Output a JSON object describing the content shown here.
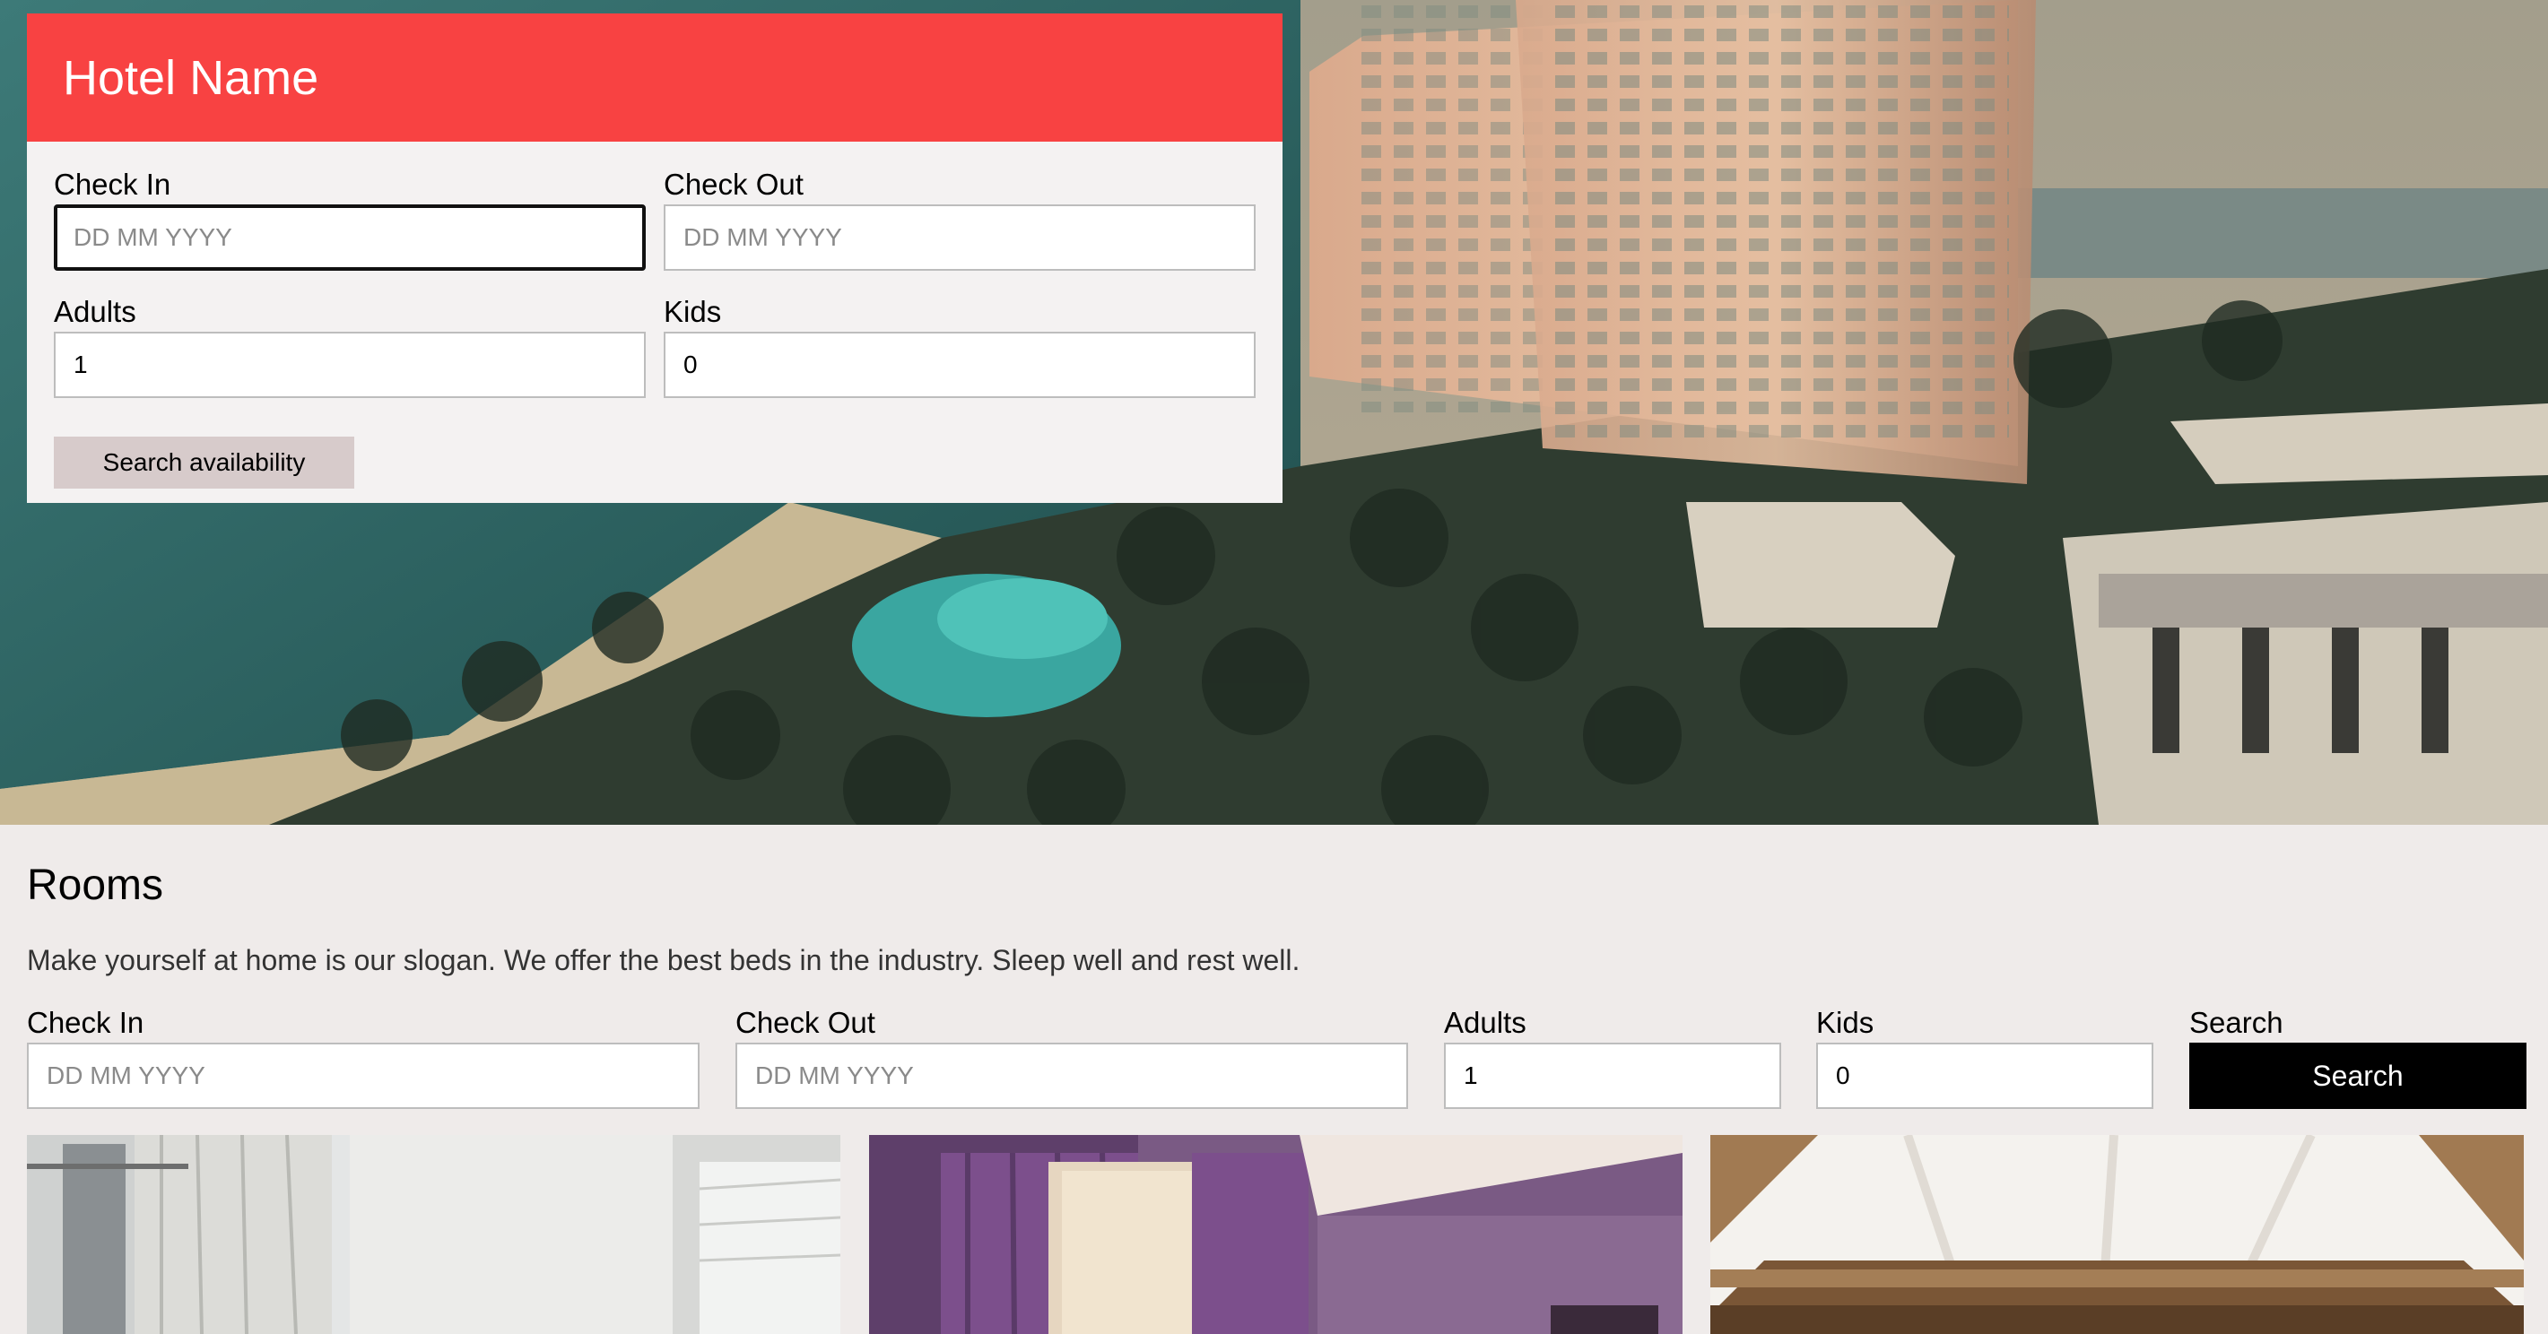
{
  "hotel": {
    "name": "Hotel Name"
  },
  "booking_form": {
    "check_in": {
      "label": "Check In",
      "placeholder": "DD MM YYYY"
    },
    "check_out": {
      "label": "Check Out",
      "placeholder": "DD MM YYYY"
    },
    "adults": {
      "label": "Adults",
      "value": "1"
    },
    "kids": {
      "label": "Kids",
      "value": "0"
    },
    "submit_label": "Search availability"
  },
  "rooms": {
    "title": "Rooms",
    "description": "Make yourself at home is our slogan. We offer the best beds in the industry. Sleep well and rest well.",
    "filter": {
      "check_in": {
        "label": "Check In",
        "placeholder": "DD MM YYYY"
      },
      "check_out": {
        "label": "Check Out",
        "placeholder": "DD MM YYYY"
      },
      "adults": {
        "label": "Adults",
        "value": "1"
      },
      "kids": {
        "label": "Kids",
        "value": "0"
      },
      "search": {
        "label": "Search",
        "button_label": "Search"
      }
    }
  },
  "colors": {
    "header_red": "#f84242",
    "card_background": "#f4f2f2",
    "page_background": "#efebea",
    "availability_button": "#d7cbcb",
    "search_button": "#000000"
  }
}
